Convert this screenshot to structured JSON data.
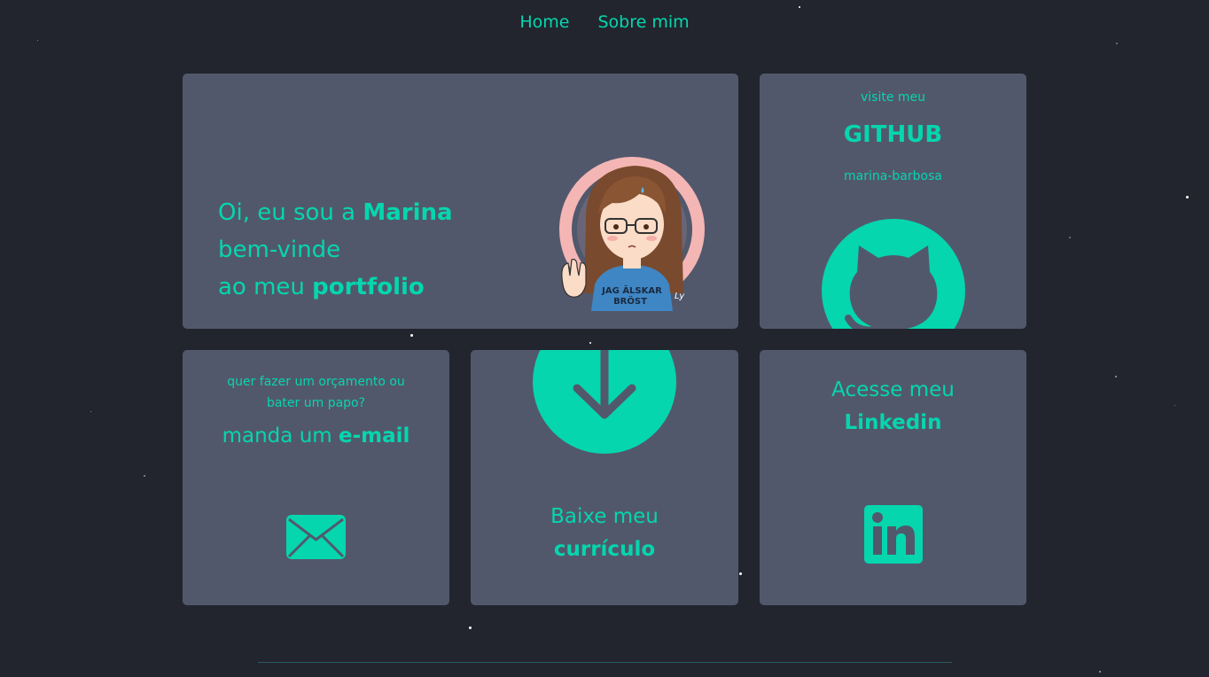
{
  "nav": {
    "items": [
      {
        "label": "Home"
      },
      {
        "label": "Sobre mim"
      }
    ]
  },
  "hero": {
    "line1_prefix": "Oi, eu sou a ",
    "line1_name": "Marina",
    "line2": "bem-vinde",
    "line3_prefix": "ao meu ",
    "line3_bold": "portfolio",
    "avatar_shirt_text": "JAG ÄLSKAR BRÖST"
  },
  "github": {
    "pre": "visite meu",
    "title": "GITHUB",
    "username": "marina-barbosa",
    "icon": "github-icon"
  },
  "email": {
    "sub_line1": "quer fazer um orçamento ou",
    "sub_line2": "bater um papo?",
    "title_prefix": "manda um ",
    "title_bold": "e-mail",
    "icon": "mail-icon"
  },
  "cv": {
    "line1": "Baixe meu",
    "line2": "currículo",
    "icon": "download-icon"
  },
  "linkedin": {
    "line1": "Acesse meu",
    "line2": "Linkedin",
    "icon": "linkedin-icon"
  },
  "colors": {
    "background": "#22252e",
    "card": "#52586c",
    "accent": "#05d6ae"
  }
}
